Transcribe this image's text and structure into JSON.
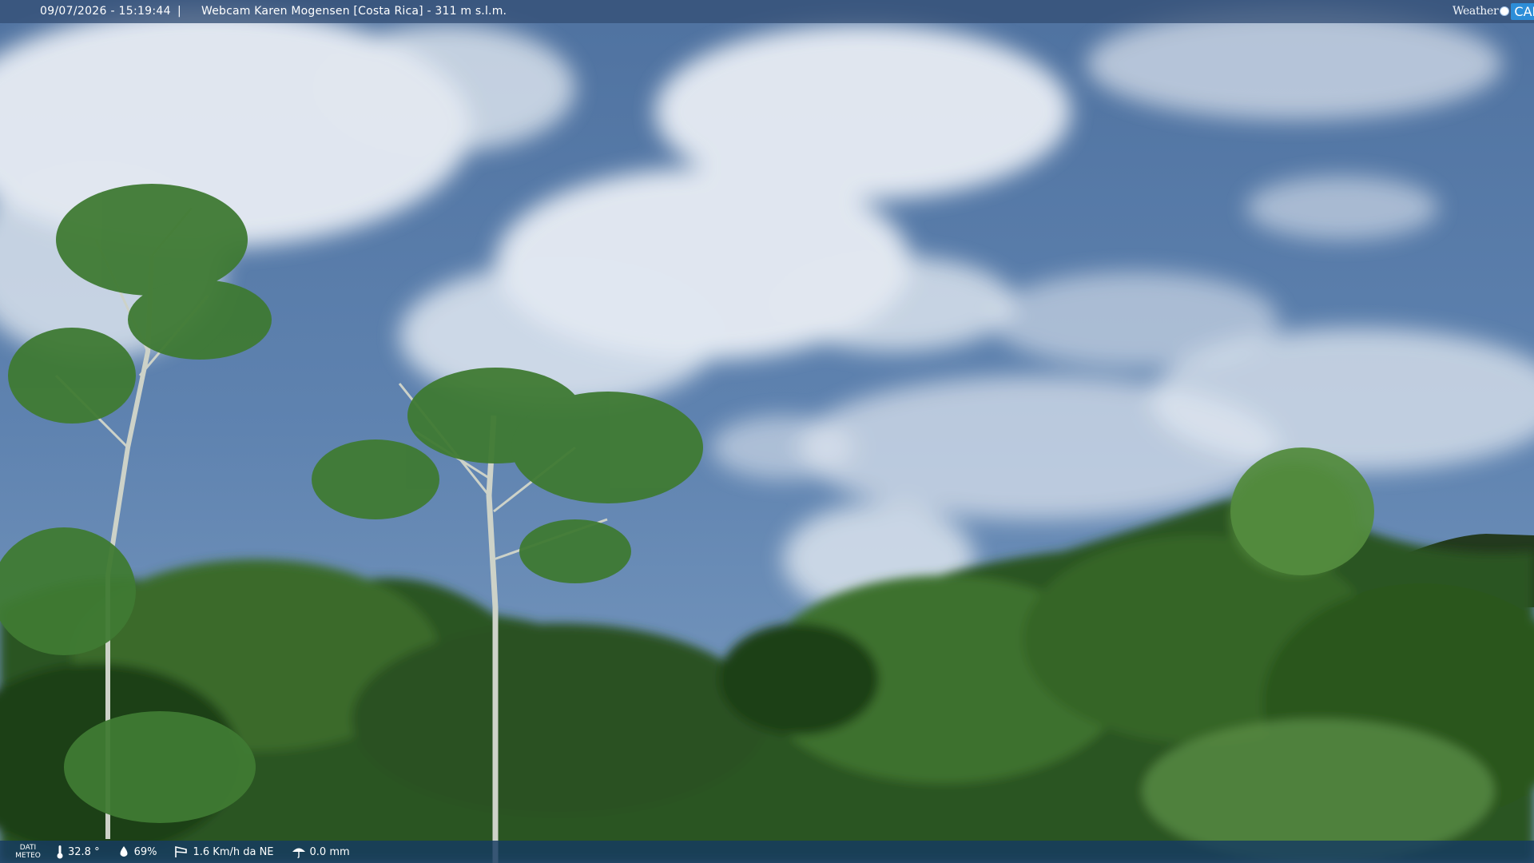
{
  "overlay_top": {
    "timestamp": "09/07/2026 - 15:19:44",
    "separator": "|",
    "title": "Webcam Karen Mogensen [Costa Rica] - 311 m s.l.m."
  },
  "logo": {
    "word": "Weather",
    "cam": "CAM"
  },
  "weather_bar": {
    "label_line1": "DATI",
    "label_line2": "METEO",
    "temperature": "32.8 °",
    "humidity": "69%",
    "wind": "1.6 Km/h da NE",
    "rain": "0.0 mm"
  },
  "colors": {
    "sky": "#5d80aa",
    "cloud": "#eef2f7",
    "foliage_dark": "#1e3f16",
    "foliage_light": "#4f8a33",
    "bar": "#163a62"
  }
}
